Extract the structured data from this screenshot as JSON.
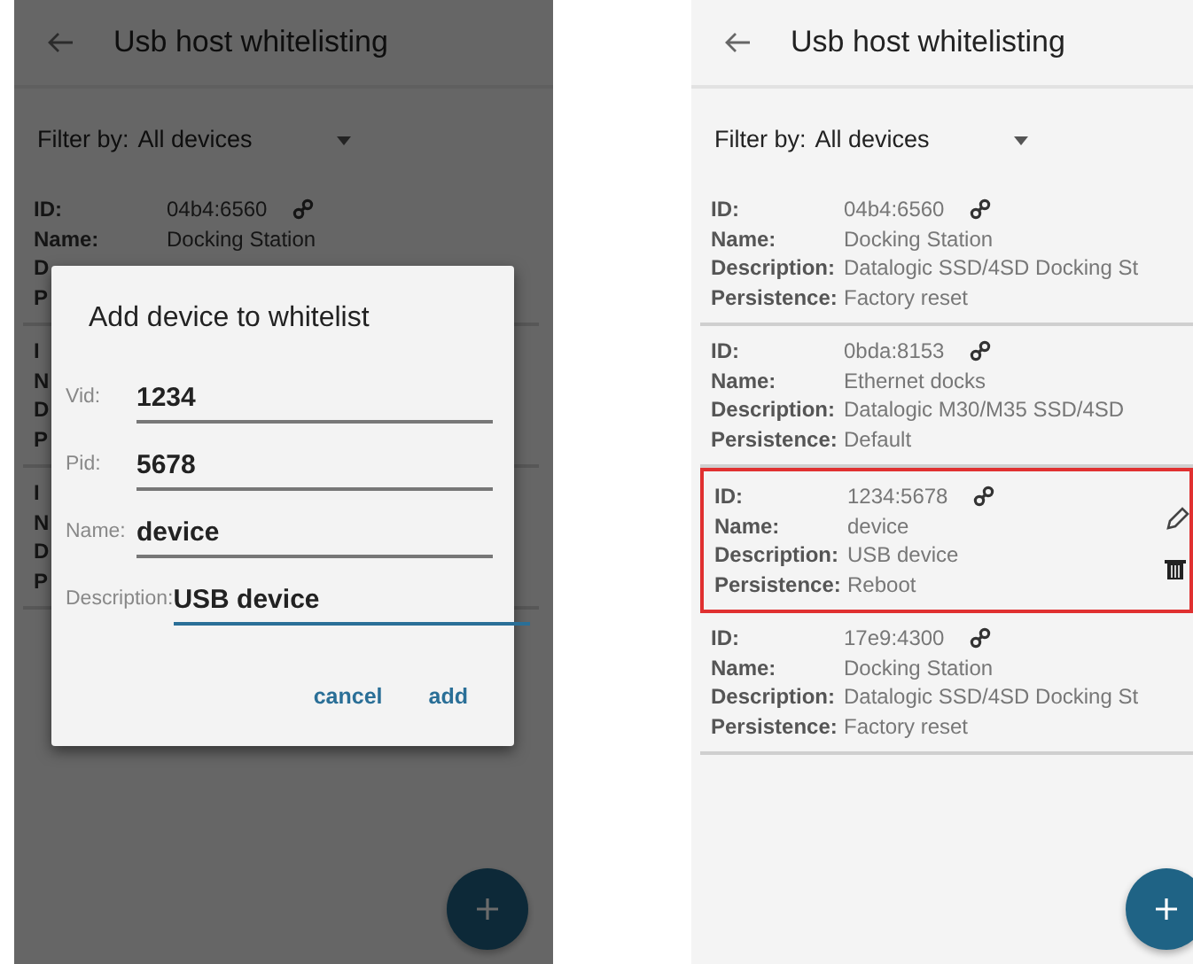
{
  "screens": [
    {
      "dimmed": true,
      "title": "Usb host whitelisting",
      "filter": {
        "label": "Filter by:",
        "value": "All devices"
      },
      "devices": [
        {
          "selected": false,
          "rows": [
            {
              "label": "ID:",
              "value": "04b4:6560"
            },
            {
              "label": "Name:",
              "value": "Docking Station"
            },
            {
              "label": "D"
            },
            {
              "label": "P"
            }
          ]
        },
        {
          "selected": false,
          "rows": [
            {
              "label": "I"
            },
            {
              "label": "N"
            },
            {
              "label": "D"
            },
            {
              "label": "P"
            }
          ]
        },
        {
          "selected": false,
          "rows": [
            {
              "label": "I"
            },
            {
              "label": "N"
            },
            {
              "label": "D"
            },
            {
              "label": "P"
            }
          ]
        }
      ],
      "dialog": {
        "title": "Add device to whitelist",
        "fields": [
          {
            "label": "Vid:",
            "value": "1234",
            "focused": false
          },
          {
            "label": "Pid:",
            "value": "5678",
            "focused": false
          },
          {
            "label": "Name:",
            "value": "device",
            "focused": false
          },
          {
            "label": "Description:",
            "value": "USB device",
            "focused": true
          }
        ],
        "buttons": [
          "cancel",
          "add"
        ]
      }
    },
    {
      "dimmed": false,
      "title": "Usb host whitelisting",
      "filter": {
        "label": "Filter by:",
        "value": "All devices"
      },
      "devices": [
        {
          "selected": false,
          "rows": [
            {
              "label": "ID:",
              "value": "04b4:6560"
            },
            {
              "label": "Name:",
              "value": "Docking Station"
            },
            {
              "label": "Description:",
              "value": "Datalogic SSD/4SD Docking St"
            },
            {
              "label": "Persistence:",
              "value": "Factory reset"
            }
          ]
        },
        {
          "selected": false,
          "rows": [
            {
              "label": "ID:",
              "value": "0bda:8153"
            },
            {
              "label": "Name:",
              "value": "Ethernet docks"
            },
            {
              "label": "Description:",
              "value": "Datalogic M30/M35 SSD/4SD"
            },
            {
              "label": "Persistence:",
              "value": "Default"
            }
          ]
        },
        {
          "selected": true,
          "rows": [
            {
              "label": "ID:",
              "value": "1234:5678"
            },
            {
              "label": "Name:",
              "value": "device"
            },
            {
              "label": "Description:",
              "value": "USB device"
            },
            {
              "label": "Persistence:",
              "value": "Reboot"
            }
          ]
        },
        {
          "selected": false,
          "rows": [
            {
              "label": "ID:",
              "value": "17e9:4300"
            },
            {
              "label": "Name:",
              "value": "Docking Station"
            },
            {
              "label": "Description:",
              "value": "Datalogic SSD/4SD Docking St"
            },
            {
              "label": "Persistence:",
              "value": "Factory reset"
            }
          ]
        }
      ]
    }
  ]
}
